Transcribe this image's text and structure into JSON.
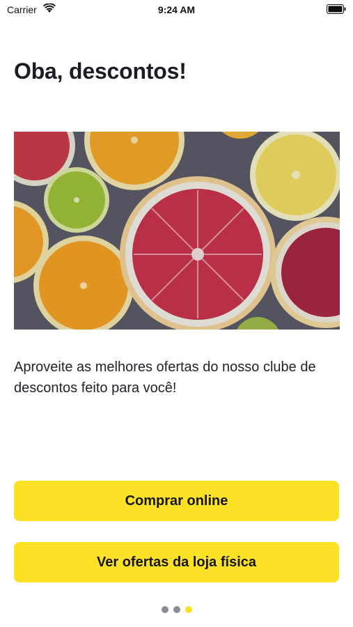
{
  "status_bar": {
    "carrier": "Carrier",
    "time": "9:24 AM",
    "icons": [
      "wifi-icon",
      "battery-icon"
    ]
  },
  "screen": {
    "title": "Oba, descontos!",
    "hero_image": "citrus-slices-photo",
    "description": "Aproveite as melhores ofertas do nosso clube de descontos feito para você!"
  },
  "actions": {
    "buy_online": "Comprar online",
    "store_offers": "Ver ofertas da loja física"
  },
  "pagination": {
    "total": 3,
    "active": 3
  },
  "colors": {
    "accent": "#fbe226",
    "inactive_dot": "#8a8d92",
    "text": "#1c1c24"
  }
}
